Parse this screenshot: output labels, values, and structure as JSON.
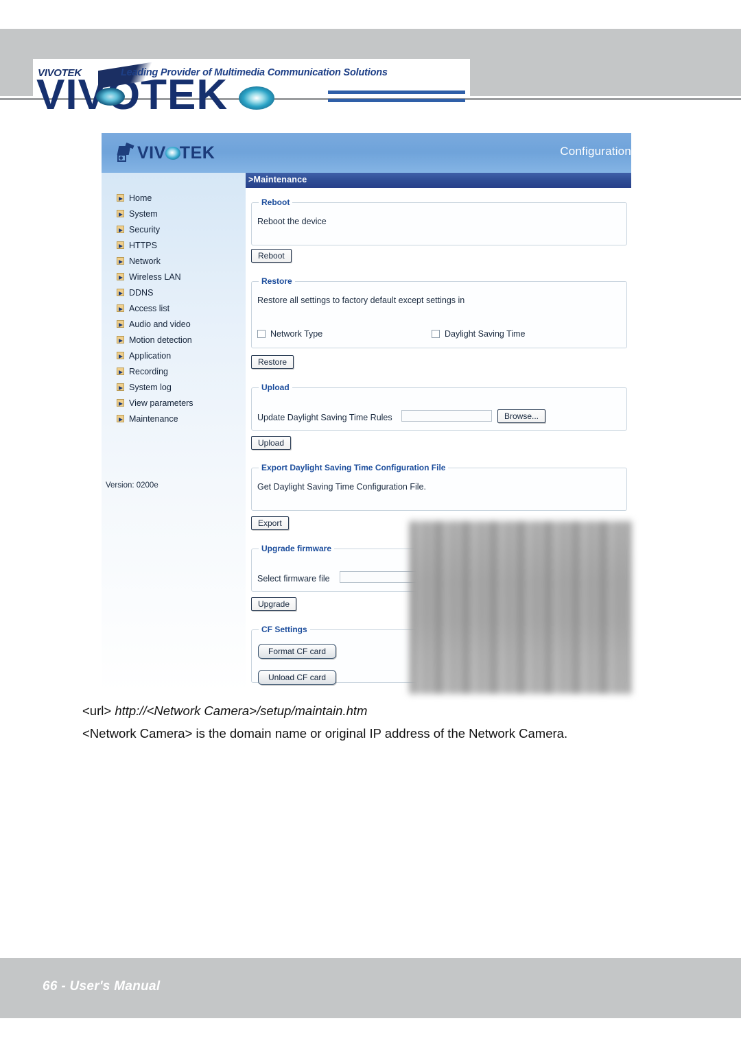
{
  "banner": {
    "brand_small": "VIVOTEK",
    "tagline": "Leading Provider of Multimedia Communication Solutions",
    "brand_big": "VIVOTEK"
  },
  "screenshot": {
    "logo_text_pre": "VIV",
    "logo_text_post": "TEK",
    "config_label": "Configuration",
    "page_header": ">Maintenance",
    "version": "Version: 0200e",
    "sidebar_items": [
      {
        "label": "Home"
      },
      {
        "label": "System"
      },
      {
        "label": "Security"
      },
      {
        "label": "HTTPS"
      },
      {
        "label": "Network"
      },
      {
        "label": "Wireless LAN"
      },
      {
        "label": "DDNS"
      },
      {
        "label": "Access list"
      },
      {
        "label": "Audio and video"
      },
      {
        "label": "Motion detection"
      },
      {
        "label": "Application"
      },
      {
        "label": "Recording"
      },
      {
        "label": "System log"
      },
      {
        "label": "View parameters"
      },
      {
        "label": "Maintenance"
      }
    ],
    "reboot": {
      "legend": "Reboot",
      "description": "Reboot the device",
      "button": "Reboot"
    },
    "restore": {
      "legend": "Restore",
      "description": "Restore all settings to factory default except settings in",
      "checkbox_network_type": "Network Type",
      "checkbox_dst": "Daylight Saving Time",
      "button": "Restore"
    },
    "upload": {
      "legend": "Upload",
      "field_label": "Update Daylight Saving Time Rules",
      "field_value": "",
      "browse_button": "Browse...",
      "button": "Upload"
    },
    "export": {
      "legend": "Export Daylight Saving Time Configuration File",
      "description": "Get Daylight Saving Time Configuration File.",
      "button": "Export"
    },
    "upgrade": {
      "legend": "Upgrade firmware",
      "field_label": "Select firmware file",
      "field_value": "",
      "button": "Upgrade"
    },
    "cf_settings": {
      "legend": "CF Settings",
      "format_button": "Format CF card",
      "unload_button": "Unload CF card"
    }
  },
  "body": {
    "url_prefix": "<url>",
    "url_value": "http://<Network Camera>/setup/maintain.htm",
    "note": "<Network Camera> is the domain name or original IP address of the Network Camera."
  },
  "footer": {
    "text": "66 - User's Manual"
  },
  "colors": {
    "band_gray": "#c4c6c7",
    "header_blue": "#6fa3da",
    "bar_blue": "#2f4d95",
    "legend_blue": "#1c4d9c",
    "brand_navy": "#1b3b7a",
    "icon_tan": "#f0cf8c"
  }
}
